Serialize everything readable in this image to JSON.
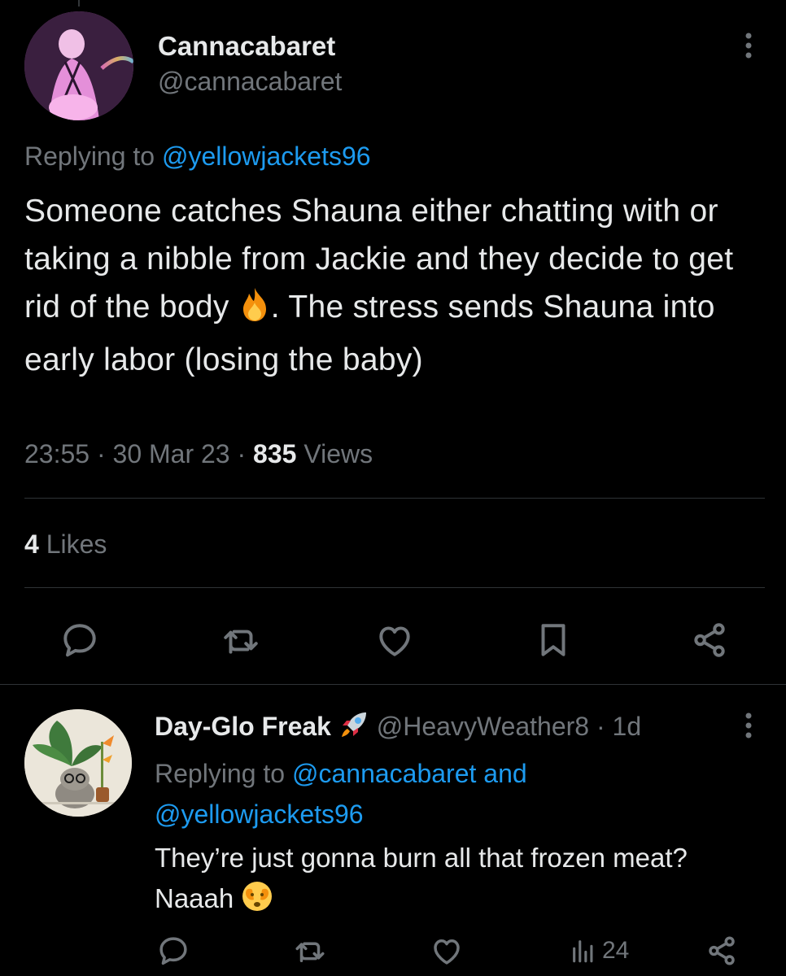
{
  "colors": {
    "background": "#000000",
    "text_primary": "#e7e9ea",
    "text_secondary": "#71767b",
    "link": "#1d9bf0",
    "divider": "#2f3336"
  },
  "main_tweet": {
    "display_name": "Cannacabaret",
    "handle": "@cannacabaret",
    "replying_prefix": "Replying to ",
    "replying_to": "@yellowjackets96",
    "text_part1": "Someone catches Shauna either chatting with or taking a nibble from Jackie and they decide to get rid of the body ",
    "emoji": "fire-emoji",
    "text_part2": ". The stress sends Shauna into early labor (losing the baby)",
    "time": "23:55",
    "sep1": " · ",
    "date": "30 Mar 23",
    "sep2": " · ",
    "views_count": "835",
    "views_label": " Views",
    "likes_count": "4",
    "likes_label": " Likes",
    "actions": [
      "reply-icon",
      "retweet-icon",
      "like-icon",
      "bookmark-icon",
      "share-icon"
    ]
  },
  "reply_tweet": {
    "display_name": "Day-Glo Freak",
    "name_emoji": "rocket-emoji",
    "handle": "@HeavyWeather8",
    "sep": " · ",
    "age": "1d",
    "replying_prefix": "Replying to ",
    "replying_to_1": "@cannacabaret",
    "replying_and": " and",
    "replying_to_2": "@yellowjackets96",
    "text_line1": "They’re just gonna burn all that frozen meat?",
    "text_line2": "Naaah ",
    "emoji": "face-with-peeking-eye-emoji",
    "views_count": "24",
    "actions": [
      "reply-icon",
      "retweet-icon",
      "like-icon",
      "views-icon",
      "share-icon"
    ]
  }
}
